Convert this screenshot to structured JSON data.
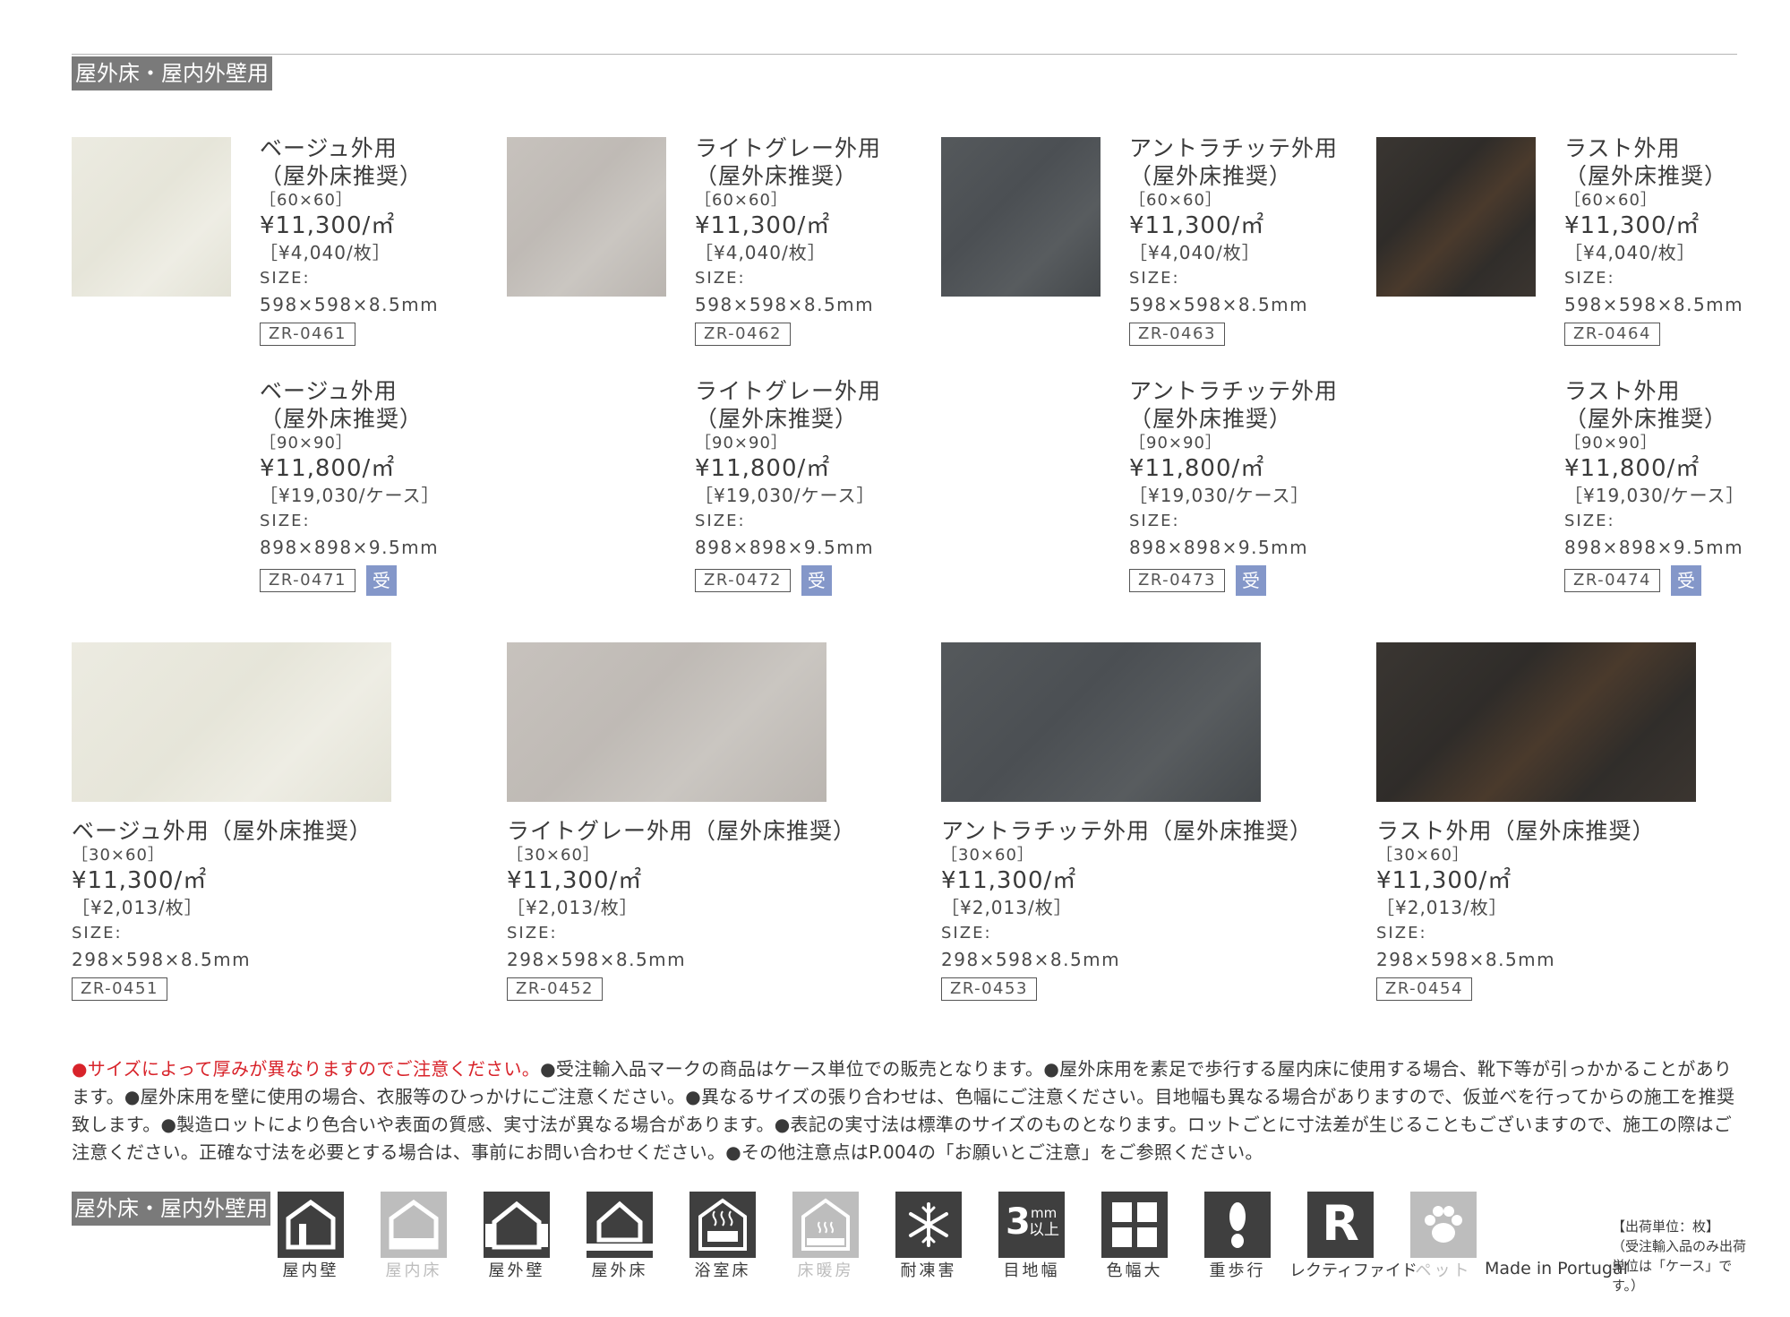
{
  "section_label": "屋外床・屋内外壁用",
  "top_products": [
    {
      "rows": [
        {
          "name1": "ベージュ外用",
          "name2": "（屋外床推奨）",
          "dim": "［60×60］",
          "price": "¥11,300/㎡",
          "unit": "［¥4,040/枚］",
          "size_label": "SIZE:",
          "size": "598×598×8.5mm",
          "code": "ZR-0461",
          "badge": ""
        },
        {
          "name1": "ベージュ外用",
          "name2": "（屋外床推奨）",
          "dim": "［90×90］",
          "price": "¥11,800/㎡",
          "unit": "［¥19,030/ケース］",
          "size_label": "SIZE:",
          "size": "898×898×9.5mm",
          "code": "ZR-0471",
          "badge": "受"
        }
      ]
    },
    {
      "rows": [
        {
          "name1": "ライトグレー外用",
          "name2": "（屋外床推奨）",
          "dim": "［60×60］",
          "price": "¥11,300/㎡",
          "unit": "［¥4,040/枚］",
          "size_label": "SIZE:",
          "size": "598×598×8.5mm",
          "code": "ZR-0462",
          "badge": ""
        },
        {
          "name1": "ライトグレー外用",
          "name2": "（屋外床推奨）",
          "dim": "［90×90］",
          "price": "¥11,800/㎡",
          "unit": "［¥19,030/ケース］",
          "size_label": "SIZE:",
          "size": "898×898×9.5mm",
          "code": "ZR-0472",
          "badge": "受"
        }
      ]
    },
    {
      "rows": [
        {
          "name1": "アントラチッテ外用",
          "name2": "（屋外床推奨）",
          "dim": "［60×60］",
          "price": "¥11,300/㎡",
          "unit": "［¥4,040/枚］",
          "size_label": "SIZE:",
          "size": "598×598×8.5mm",
          "code": "ZR-0463",
          "badge": ""
        },
        {
          "name1": "アントラチッテ外用",
          "name2": "（屋外床推奨）",
          "dim": "［90×90］",
          "price": "¥11,800/㎡",
          "unit": "［¥19,030/ケース］",
          "size_label": "SIZE:",
          "size": "898×898×9.5mm",
          "code": "ZR-0473",
          "badge": "受"
        }
      ]
    },
    {
      "rows": [
        {
          "name1": "ラスト外用",
          "name2": "（屋外床推奨）",
          "dim": "［60×60］",
          "price": "¥11,300/㎡",
          "unit": "［¥4,040/枚］",
          "size_label": "SIZE:",
          "size": "598×598×8.5mm",
          "code": "ZR-0464",
          "badge": ""
        },
        {
          "name1": "ラスト外用",
          "name2": "（屋外床推奨）",
          "dim": "［90×90］",
          "price": "¥11,800/㎡",
          "unit": "［¥19,030/ケース］",
          "size_label": "SIZE:",
          "size": "898×898×9.5mm",
          "code": "ZR-0474",
          "badge": "受"
        }
      ]
    }
  ],
  "bottom_products": [
    {
      "name": "ベージュ外用（屋外床推奨）",
      "dim": "［30×60］",
      "price": "¥11,300/㎡",
      "unit": "［¥2,013/枚］",
      "size_label": "SIZE:",
      "size": "298×598×8.5mm",
      "code": "ZR-0451"
    },
    {
      "name": "ライトグレー外用（屋外床推奨）",
      "dim": "［30×60］",
      "price": "¥11,300/㎡",
      "unit": "［¥2,013/枚］",
      "size_label": "SIZE:",
      "size": "298×598×8.5mm",
      "code": "ZR-0452"
    },
    {
      "name": "アントラチッテ外用（屋外床推奨）",
      "dim": "［30×60］",
      "price": "¥11,300/㎡",
      "unit": "［¥2,013/枚］",
      "size_label": "SIZE:",
      "size": "298×598×8.5mm",
      "code": "ZR-0453"
    },
    {
      "name": "ラスト外用（屋外床推奨）",
      "dim": "［30×60］",
      "price": "¥11,300/㎡",
      "unit": "［¥2,013/枚］",
      "size_label": "SIZE:",
      "size": "298×598×8.5mm",
      "code": "ZR-0454"
    }
  ],
  "notes": {
    "red": "●サイズによって厚みが異なりますのでご注意ください。",
    "body": "●受注輸入品マークの商品はケース単位での販売となります。●屋外床用を素足で歩行する屋内床に使用する場合、靴下等が引っかかることがあります。●屋外床用を壁に使用の場合、衣服等のひっかけにご注意ください。●異なるサイズの張り合わせは、色幅にご注意ください。目地幅も異なる場合がありますので、仮並べを行ってからの施工を推奨致します。●製造ロットにより色合いや表面の質感、実寸法が異なる場合があります。●表記の実寸法は標準のサイズのものとなります。ロットごとに寸法差が生じることもございますので、施工の際はご注意ください。正確な寸法を必要とする場合は、事前にお問い合わせください。●その他注意点はP.004の「お願いとご注意」をご参照ください。"
  },
  "legend_label": "屋外床・屋内外壁用",
  "icons": [
    {
      "icon": "indoor-wall-icon",
      "label": "屋内壁",
      "enabled": true
    },
    {
      "icon": "indoor-floor-icon",
      "label": "屋内床",
      "enabled": false
    },
    {
      "icon": "outdoor-wall-icon",
      "label": "屋外壁",
      "enabled": true
    },
    {
      "icon": "outdoor-floor-icon",
      "label": "屋外床",
      "enabled": true
    },
    {
      "icon": "bathroom-floor-icon",
      "label": "浴室床",
      "enabled": true
    },
    {
      "icon": "floor-heating-icon",
      "label": "床暖房",
      "enabled": false
    },
    {
      "icon": "frost-resistant-icon",
      "label": "耐凍害",
      "enabled": true
    },
    {
      "icon": "joint-width-icon",
      "label": "目地幅",
      "enabled": true,
      "text_big": "3",
      "text_small1": "mm",
      "text_small2": "以上"
    },
    {
      "icon": "color-variation-icon",
      "label": "色幅大",
      "enabled": true
    },
    {
      "icon": "heavy-traffic-icon",
      "label": "重歩行",
      "enabled": true
    },
    {
      "icon": "rectified-icon",
      "label": "レクティファイド",
      "enabled": true,
      "text_big": "R"
    },
    {
      "icon": "pet-icon",
      "label": "ペット",
      "enabled": false
    }
  ],
  "made_in": "Made in Portugal",
  "shipping_note": [
    "【出荷単位：枚】",
    "（受注輸入品のみ出荷",
    "単位は「ケース」です。）"
  ],
  "colors": {
    "badge": "#8497c9",
    "label_bg": "#7a7a7a",
    "icon_bg": "#3f3f3f",
    "icon_disabled": "#bdbdbd",
    "warning_red": "#d8232a"
  }
}
